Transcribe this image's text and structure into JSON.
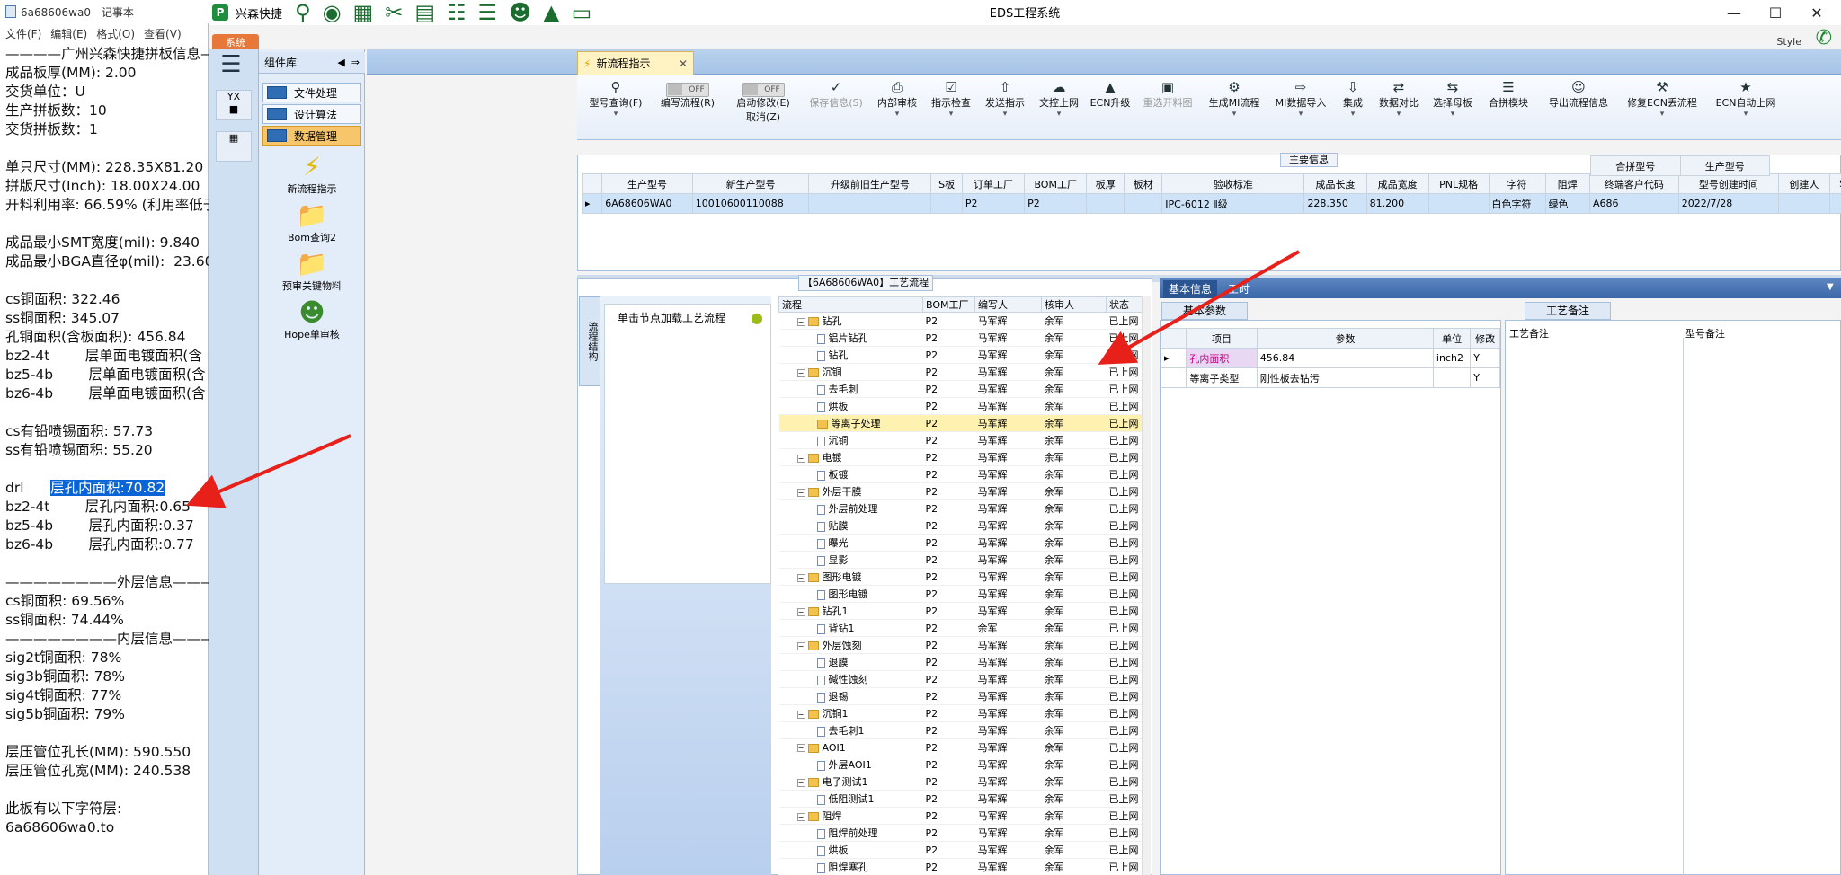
{
  "notepad": {
    "title": "6a68606wa0 - 记事本",
    "menu": [
      "文件(F)",
      "编辑(E)",
      "格式(O)",
      "查看(V)"
    ],
    "lines": [
      "————广州兴森快捷拼板信息————",
      "成品板厚(MM): 2.00",
      "交货单位：U",
      "生产拼板数：10",
      "交货拼板数：1",
      "",
      "单只尺寸(MM): 228.35X81.20",
      "拼版尺寸(Inch): 18.00X24.00",
      "开料利用率: 66.59% (利用率低于",
      "",
      "成品最小SMT宽度(mil): 9.840",
      "成品最小BGA直径φ(mil):  23.60",
      "",
      "cs铜面积: 322.46",
      "ss铜面积: 345.07",
      "孔铜面积(含板面积): 456.84",
      "bz2-4t        层单面电镀面积(含",
      "bz5-4b        层单面电镀面积(含",
      "bz6-4b        层单面电镀面积(含",
      "",
      "cs有铅喷锡面积: 57.73",
      "ss有铅喷锡面积: 55.20",
      "",
      "drl",
      "bz2-4t        层孔内面积:0.65",
      "bz5-4b        层孔内面积:0.37",
      "bz6-4b        层孔内面积:0.77",
      "",
      "————————外层信息————————",
      "cs铜面积: 69.56%",
      "ss铜面积: 74.44%",
      "————————内层信息————————",
      "sig2t铜面积: 78%",
      "sig3b铜面积: 78%",
      "sig4t铜面积: 77%",
      "sig5b铜面积: 79%",
      "",
      "层压管位孔长(MM): 590.550",
      "层压管位孔宽(MM): 240.538",
      "",
      "此板有以下字符层:",
      "6a68606wa0.to"
    ],
    "selected_text": "层孔内面积:70.82"
  },
  "app": {
    "name": "兴森快捷",
    "title": "EDS工程系统",
    "system_tab": "系统",
    "style_label": "Style",
    "quick_icons": [
      "search-icon",
      "globe-icon",
      "grid-icon",
      "scissors-icon",
      "film-icon",
      "clipboard-icon",
      "list-icon",
      "user-icon",
      "chart-icon",
      "monitor-icon"
    ]
  },
  "component_library": {
    "title": "组件库",
    "groups": [
      {
        "label": "文件处理"
      },
      {
        "label": "设计算法"
      },
      {
        "label": "数据管理"
      }
    ],
    "items": [
      {
        "label": "新流程指示",
        "icon": "lightning-icon"
      },
      {
        "label": "Bom查询2",
        "icon": "folder-icon"
      },
      {
        "label": "预审关键物料",
        "icon": "folder-icon"
      },
      {
        "label": "Hope单审核",
        "icon": "user-icon"
      }
    ]
  },
  "tab": {
    "label": "新流程指示"
  },
  "toolbar": [
    {
      "label": "型号查询(F)",
      "icon": "search-icon"
    },
    {
      "label": "编写流程(R)",
      "toggle": "OFF"
    },
    {
      "label": "启动修改(E)",
      "label2": "取消(Z)",
      "toggle": "OFF"
    },
    {
      "label": "保存信息(S)",
      "icon": "check-icon",
      "disabled": true
    },
    {
      "label": "内部审核",
      "icon": "printer-icon"
    },
    {
      "label": "指示检查",
      "icon": "check-box-icon"
    },
    {
      "label": "发送指示",
      "icon": "upload-icon"
    },
    {
      "label": "文控上网",
      "icon": "cloud-upload-icon"
    },
    {
      "label": "ECN升级",
      "icon": "ecn-icon"
    },
    {
      "label": "重选开料图",
      "icon": "image-icon",
      "disabled": true
    },
    {
      "label": "生成MI流程",
      "icon": "gears-icon"
    },
    {
      "label": "MI数据导入",
      "icon": "import-icon"
    },
    {
      "label": "集成",
      "icon": "download-icon"
    },
    {
      "label": "数据对比",
      "icon": "compare-icon"
    },
    {
      "label": "选择母板",
      "icon": "shuffle-icon"
    },
    {
      "label": "合拼模块",
      "icon": "list-icon"
    },
    {
      "label": "导出流程信息",
      "icon": "smile-icon"
    },
    {
      "label": "修复ECN丢流程",
      "icon": "wrench-icon"
    },
    {
      "label": "ECN自动上网",
      "icon": "star-icon"
    }
  ],
  "main_info": {
    "caption": "主要信息",
    "columns": [
      "生产型号",
      "新生产型号",
      "升级前旧生产型号",
      "S板",
      "订单工厂",
      "BOM工厂",
      "板厚",
      "板材",
      "验收标准",
      "成品长度",
      "成品宽度",
      "PNL规格",
      "字符",
      "阻焊",
      "终端客户代码",
      "型号创建时间",
      "创建人",
      "SO"
    ],
    "row": [
      "6A68606WA0",
      "10010600110088",
      "",
      "",
      "P2",
      "P2",
      "",
      "",
      "IPC-6012 Ⅱ级",
      "228.350",
      "81.200",
      "",
      "白色字符",
      "绿色",
      "A686",
      "2022/7/28",
      "",
      ""
    ],
    "side_columns": [
      "合拼型号",
      "生产型号"
    ]
  },
  "flow": {
    "caption": "【6A68606WA0】工艺流程",
    "side_tab": "流程结构",
    "click_hint": "单击节点加载工艺流程",
    "columns": [
      "流程",
      "BOM工厂",
      "编写人",
      "核审人",
      "状态"
    ],
    "rows": [
      {
        "name": "钻孔",
        "level": 0,
        "type": "folder",
        "bom": "P2",
        "writer": "马军辉",
        "reviewer": "余军",
        "status": "已上网"
      },
      {
        "name": "铝片钻孔",
        "level": 1,
        "type": "doc",
        "bom": "P2",
        "writer": "马军辉",
        "reviewer": "余军",
        "status": "已上网"
      },
      {
        "name": "钻孔",
        "level": 1,
        "type": "doc",
        "bom": "P2",
        "writer": "马军辉",
        "reviewer": "余军",
        "status": "已上网"
      },
      {
        "name": "沉铜",
        "level": 0,
        "type": "folder",
        "bom": "P2",
        "writer": "马军辉",
        "reviewer": "余军",
        "status": "已上网"
      },
      {
        "name": "去毛刺",
        "level": 1,
        "type": "doc",
        "bom": "P2",
        "writer": "马军辉",
        "reviewer": "余军",
        "status": "已上网"
      },
      {
        "name": "烘板",
        "level": 1,
        "type": "doc",
        "bom": "P2",
        "writer": "马军辉",
        "reviewer": "余军",
        "status": "已上网"
      },
      {
        "name": "等离子处理",
        "level": 1,
        "type": "folder",
        "bom": "P2",
        "writer": "马军辉",
        "reviewer": "余军",
        "status": "已上网",
        "highlight": true
      },
      {
        "name": "沉铜",
        "level": 1,
        "type": "doc",
        "bom": "P2",
        "writer": "马军辉",
        "reviewer": "余军",
        "status": "已上网"
      },
      {
        "name": "电镀",
        "level": 0,
        "type": "folder",
        "bom": "P2",
        "writer": "马军辉",
        "reviewer": "余军",
        "status": "已上网"
      },
      {
        "name": "板镀",
        "level": 1,
        "type": "doc",
        "bom": "P2",
        "writer": "马军辉",
        "reviewer": "余军",
        "status": "已上网"
      },
      {
        "name": "外层干膜",
        "level": 0,
        "type": "folder",
        "bom": "P2",
        "writer": "马军辉",
        "reviewer": "余军",
        "status": "已上网"
      },
      {
        "name": "外层前处理",
        "level": 1,
        "type": "doc",
        "bom": "P2",
        "writer": "马军辉",
        "reviewer": "余军",
        "status": "已上网"
      },
      {
        "name": "贴膜",
        "level": 1,
        "type": "doc",
        "bom": "P2",
        "writer": "马军辉",
        "reviewer": "余军",
        "status": "已上网"
      },
      {
        "name": "曝光",
        "level": 1,
        "type": "doc",
        "bom": "P2",
        "writer": "马军辉",
        "reviewer": "余军",
        "status": "已上网"
      },
      {
        "name": "显影",
        "level": 1,
        "type": "doc",
        "bom": "P2",
        "writer": "马军辉",
        "reviewer": "余军",
        "status": "已上网"
      },
      {
        "name": "图形电镀",
        "level": 0,
        "type": "folder",
        "bom": "P2",
        "writer": "马军辉",
        "reviewer": "余军",
        "status": "已上网"
      },
      {
        "name": "图形电镀",
        "level": 1,
        "type": "doc",
        "bom": "P2",
        "writer": "马军辉",
        "reviewer": "余军",
        "status": "已上网"
      },
      {
        "name": "钻孔1",
        "level": 0,
        "type": "folder",
        "bom": "P2",
        "writer": "马军辉",
        "reviewer": "余军",
        "status": "已上网"
      },
      {
        "name": "背钻1",
        "level": 1,
        "type": "doc",
        "bom": "P2",
        "writer": "余军",
        "reviewer": "余军",
        "status": "已上网"
      },
      {
        "name": "外层蚀刻",
        "level": 0,
        "type": "folder",
        "bom": "P2",
        "writer": "马军辉",
        "reviewer": "余军",
        "status": "已上网"
      },
      {
        "name": "退膜",
        "level": 1,
        "type": "doc",
        "bom": "P2",
        "writer": "马军辉",
        "reviewer": "余军",
        "status": "已上网"
      },
      {
        "name": "碱性蚀刻",
        "level": 1,
        "type": "doc",
        "bom": "P2",
        "writer": "马军辉",
        "reviewer": "余军",
        "status": "已上网"
      },
      {
        "name": "退锡",
        "level": 1,
        "type": "doc",
        "bom": "P2",
        "writer": "马军辉",
        "reviewer": "余军",
        "status": "已上网"
      },
      {
        "name": "沉铜1",
        "level": 0,
        "type": "folder",
        "bom": "P2",
        "writer": "马军辉",
        "reviewer": "余军",
        "status": "已上网"
      },
      {
        "name": "去毛刺1",
        "level": 1,
        "type": "doc",
        "bom": "P2",
        "writer": "马军辉",
        "reviewer": "余军",
        "status": "已上网"
      },
      {
        "name": "AOI1",
        "level": 0,
        "type": "folder",
        "bom": "P2",
        "writer": "马军辉",
        "reviewer": "余军",
        "status": "已上网"
      },
      {
        "name": "外层AOI1",
        "level": 1,
        "type": "doc",
        "bom": "P2",
        "writer": "马军辉",
        "reviewer": "余军",
        "status": "已上网"
      },
      {
        "name": "电子测试1",
        "level": 0,
        "type": "folder",
        "bom": "P2",
        "writer": "马军辉",
        "reviewer": "余军",
        "status": "已上网"
      },
      {
        "name": "低阻测试1",
        "level": 1,
        "type": "doc",
        "bom": "P2",
        "writer": "马军辉",
        "reviewer": "余军",
        "status": "已上网"
      },
      {
        "name": "阻焊",
        "level": 0,
        "type": "folder",
        "bom": "P2",
        "writer": "马军辉",
        "reviewer": "余军",
        "status": "已上网"
      },
      {
        "name": "阻焊前处理",
        "level": 1,
        "type": "doc",
        "bom": "P2",
        "writer": "马军辉",
        "reviewer": "余军",
        "status": "已上网"
      },
      {
        "name": "烘板",
        "level": 1,
        "type": "doc",
        "bom": "P2",
        "writer": "马军辉",
        "reviewer": "余军",
        "status": "已上网"
      },
      {
        "name": "阻焊塞孔",
        "level": 1,
        "type": "doc",
        "bom": "P2",
        "writer": "马军辉",
        "reviewer": "余军",
        "status": "已上网"
      }
    ]
  },
  "basic_info": {
    "tabs": [
      "基本信息",
      "工时"
    ],
    "caption": "基本参数",
    "columns": [
      "项目",
      "参数",
      "单位",
      "修改"
    ],
    "rows": [
      {
        "item": "孔内面积",
        "value": "456.84",
        "unit": "inch2",
        "modify": "Y"
      },
      {
        "item": "等离子类型",
        "value": "刚性板去钻污",
        "unit": "",
        "modify": "Y"
      }
    ]
  },
  "craft_notes": {
    "caption": "工艺备注",
    "columns": [
      "工艺备注",
      "型号备注"
    ]
  },
  "colors": {
    "arrow": "#e8201a",
    "accent_blue": "#2f6db5",
    "highlight": "#fff2b0",
    "selection": "#0a64d6"
  }
}
